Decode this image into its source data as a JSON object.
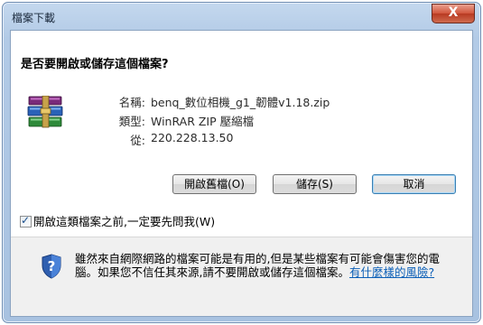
{
  "window": {
    "title": "檔案下載",
    "close_label": "X"
  },
  "dialog": {
    "headline": "是否要開啟或儲存這個檔案?",
    "fields": [
      {
        "label": "名稱:",
        "value": "benq_數位相機_g1_韌體v1.18.zip"
      },
      {
        "label": "類型:",
        "value": "WinRAR ZIP 壓縮檔"
      },
      {
        "label": "從:",
        "value": "220.228.13.50"
      }
    ],
    "buttons": {
      "open_label": "開啟舊檔(O)",
      "save_label": "儲存(S)",
      "cancel_label": "取消"
    },
    "always_ask": {
      "checked": true,
      "label": "開啟這類檔案之前,一定要先問我(W)"
    }
  },
  "footer": {
    "warning_text": "雖然來自網際網路的檔案可能是有用的,但是某些檔案有可能會傷害您的電腦。如果您不信任其來源,請不要開啟或儲存這個檔案。",
    "link_text": "有什麼樣的風險?"
  },
  "icons": {
    "file_icon": "winrar-archive-icon",
    "security_icon": "shield-question-icon",
    "checkbox_icon": "checkmark-icon"
  },
  "colors": {
    "link": "#0b5fb7",
    "frame": "#b2cae6",
    "close": "#d1543b"
  }
}
